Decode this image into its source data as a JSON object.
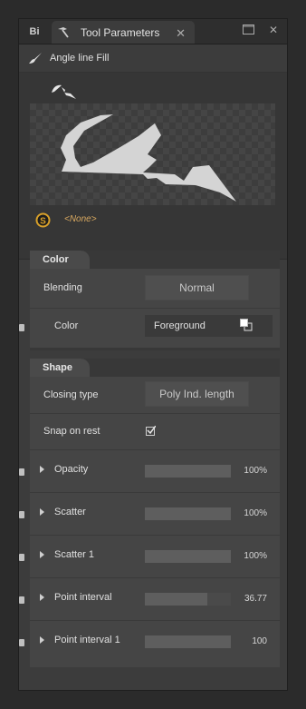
{
  "window": {
    "tab_bi": "Bi",
    "tab_title": "Tool Parameters",
    "tab_close": "✕",
    "btn_maximize": "▭",
    "btn_close": "✕"
  },
  "tool": {
    "name": "Angle line Fill"
  },
  "brush": {
    "texture_label": "<None>"
  },
  "color_section": {
    "title": "Color",
    "blending_label": "Blending",
    "blending_value": "Normal",
    "color_label": "Color",
    "color_value": "Foreground"
  },
  "shape_section": {
    "title": "Shape",
    "closing_type_label": "Closing type",
    "closing_type_value": "Poly Ind. length",
    "snap_label": "Snap on rest",
    "snap_checked": true,
    "params": [
      {
        "label": "Opacity",
        "value": "100%",
        "fraction": 1.0
      },
      {
        "label": "Scatter",
        "value": "100%",
        "fraction": 1.0
      },
      {
        "label": "Scatter 1",
        "value": "100%",
        "fraction": 1.0
      },
      {
        "label": "Point interval",
        "value": "36.77",
        "fraction": 0.73
      },
      {
        "label": "Point interval 1",
        "value": "100",
        "fraction": 1.0
      }
    ]
  },
  "colors": {
    "accent": "#d8a860",
    "panel": "#3c3c3c",
    "row": "#454545"
  }
}
